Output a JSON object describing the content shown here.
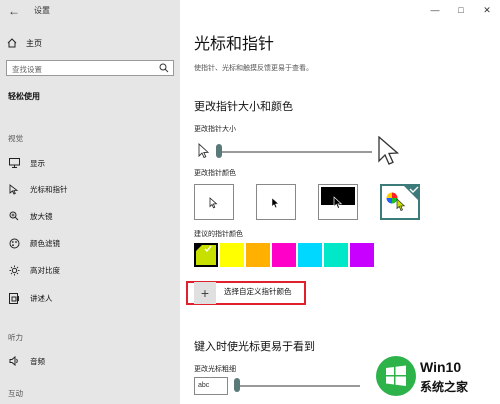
{
  "app": {
    "title": "设置"
  },
  "sidebar": {
    "home": "主页",
    "search_placeholder": "查找设置",
    "section": "轻松使用",
    "group_vision": "视觉",
    "items": [
      {
        "label": "显示",
        "icon": "monitor-icon"
      },
      {
        "label": "光标和指针",
        "icon": "cursor-icon"
      },
      {
        "label": "放大镜",
        "icon": "magnifier-icon"
      },
      {
        "label": "颜色滤镜",
        "icon": "color-filter-icon"
      },
      {
        "label": "高对比度",
        "icon": "brightness-icon"
      },
      {
        "label": "讲述人",
        "icon": "narrator-icon"
      }
    ],
    "group_hearing": "听力",
    "hearing_items": [
      {
        "label": "音频",
        "icon": "speaker-icon"
      }
    ],
    "group_interaction": "互动"
  },
  "main": {
    "title": "光标和指针",
    "description": "使指针、光标和触摸反馈更易于查看。",
    "pointer_size_heading": "更改指针大小和颜色",
    "pointer_size_label": "更改指针大小",
    "pointer_size_value": 0.0,
    "pointer_color_label": "更改指针颜色",
    "suggested_colors_label": "建议的指针颜色",
    "suggested_colors": [
      "#c8e000",
      "#ffff00",
      "#ffb000",
      "#ff00c8",
      "#00d8ff",
      "#00e8c8",
      "#c800ff"
    ],
    "custom_color_label": "选择自定义指针颜色",
    "cursor_heading": "键入时使光标更易于看到",
    "cursor_thickness_label": "更改光标粗细",
    "cursor_sample_text": "abc",
    "cursor_thickness_value": 0.0
  },
  "watermark": {
    "line1": "Win10",
    "line2": "系统之家"
  },
  "colors": {
    "accent_red": "#e0202c",
    "thumb": "#5a7a7a",
    "selected_teal": "#3d7a7a"
  }
}
